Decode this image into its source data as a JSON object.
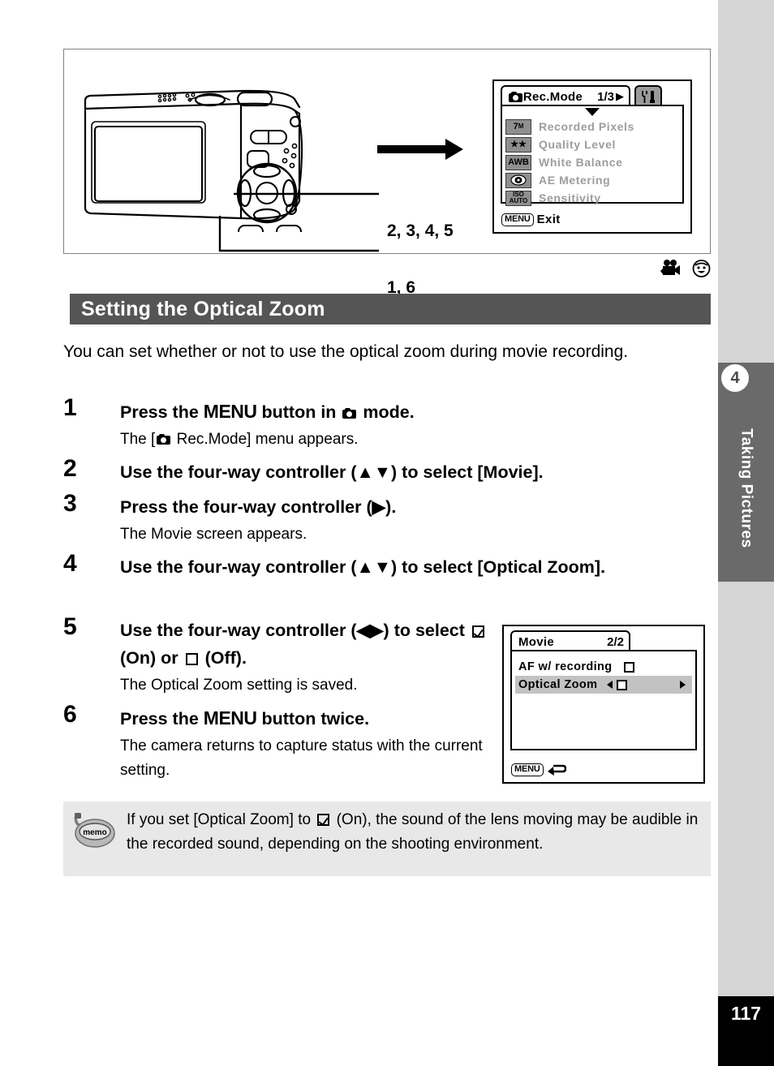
{
  "page": {
    "number": "117",
    "chapter_number": "4",
    "chapter_title": "Taking Pictures"
  },
  "illustration": {
    "callout_controller": "2, 3, 4, 5",
    "callout_menu_button": "1, 6",
    "arrow": "right-arrow"
  },
  "rec_mode_screen": {
    "tab_icon": "camera-icon",
    "title": "Rec.Mode",
    "page_indicator": "1/3",
    "page_arrow": "▶",
    "side_tab_icon": "setup-wrench-icon",
    "caret": "down-caret",
    "items": [
      {
        "icon_text": "7M",
        "icon_name": "recorded-pixels-icon",
        "label": "Recorded Pixels"
      },
      {
        "icon_text": "★★",
        "icon_name": "quality-level-icon",
        "label": "Quality Level"
      },
      {
        "icon_text": "AWB",
        "icon_name": "white-balance-icon",
        "label": "White Balance"
      },
      {
        "icon_text": "◉",
        "icon_name": "ae-metering-icon",
        "label": "AE Metering"
      },
      {
        "icon_text": "ISO AUTO",
        "icon_name": "sensitivity-icon",
        "label": "Sensitivity"
      }
    ],
    "footer_chip": "MENU",
    "footer_label": "Exit"
  },
  "movie_screen": {
    "title": "Movie",
    "page_indicator": "2/2",
    "items": [
      {
        "label": "AF w/ recording",
        "value": "off",
        "selected": false
      },
      {
        "label": "Optical Zoom",
        "value": "off",
        "selected": true
      }
    ],
    "footer_chip": "MENU",
    "footer_icon": "back-arrow-icon"
  },
  "mode_icons": [
    {
      "name": "movie-mode-icon"
    },
    {
      "name": "kids-mode-icon"
    }
  ],
  "section": {
    "heading": "Setting the Optical Zoom",
    "intro": "You can set whether or not to use the optical zoom during movie recording."
  },
  "steps": [
    {
      "number": "1",
      "title_pre": "Press the ",
      "title_menu": "MENU",
      "title_mid": " button in ",
      "title_post": " mode.",
      "desc_pre": "The [",
      "desc_post": " Rec.Mode] menu appears."
    },
    {
      "number": "2",
      "title": "Use the four-way controller (▲▼) to select [Movie]."
    },
    {
      "number": "3",
      "title": "Press the four-way controller (▶).",
      "desc": "The Movie screen appears."
    },
    {
      "number": "4",
      "title": "Use the four-way controller (▲▼) to select [Optical Zoom]."
    },
    {
      "number": "5",
      "title_pre": "Use the four-way controller (◀▶) to select ",
      "title_on": " (On) or ",
      "title_off": " (Off).",
      "desc": "The Optical Zoom setting is saved."
    },
    {
      "number": "6",
      "title_pre": "Press the ",
      "title_menu": "MENU",
      "title_post": " button twice.",
      "desc": "The camera returns to capture status with the current setting."
    }
  ],
  "memo": {
    "badge_label": "memo",
    "text_pre": "If you set [Optical Zoom] to ",
    "text_post": " (On), the sound of the lens moving may be audible in the recorded sound, depending on the shooting environment."
  },
  "colors": {
    "section_header_bg": "#555555",
    "rail_bg": "#d5d5d5",
    "rail_tab_bg": "#6a6a6a",
    "memo_bg": "#e8e8e8",
    "lcd_dim_text": "#9d9d9d",
    "lcd_highlight": "#c2c2c2"
  }
}
